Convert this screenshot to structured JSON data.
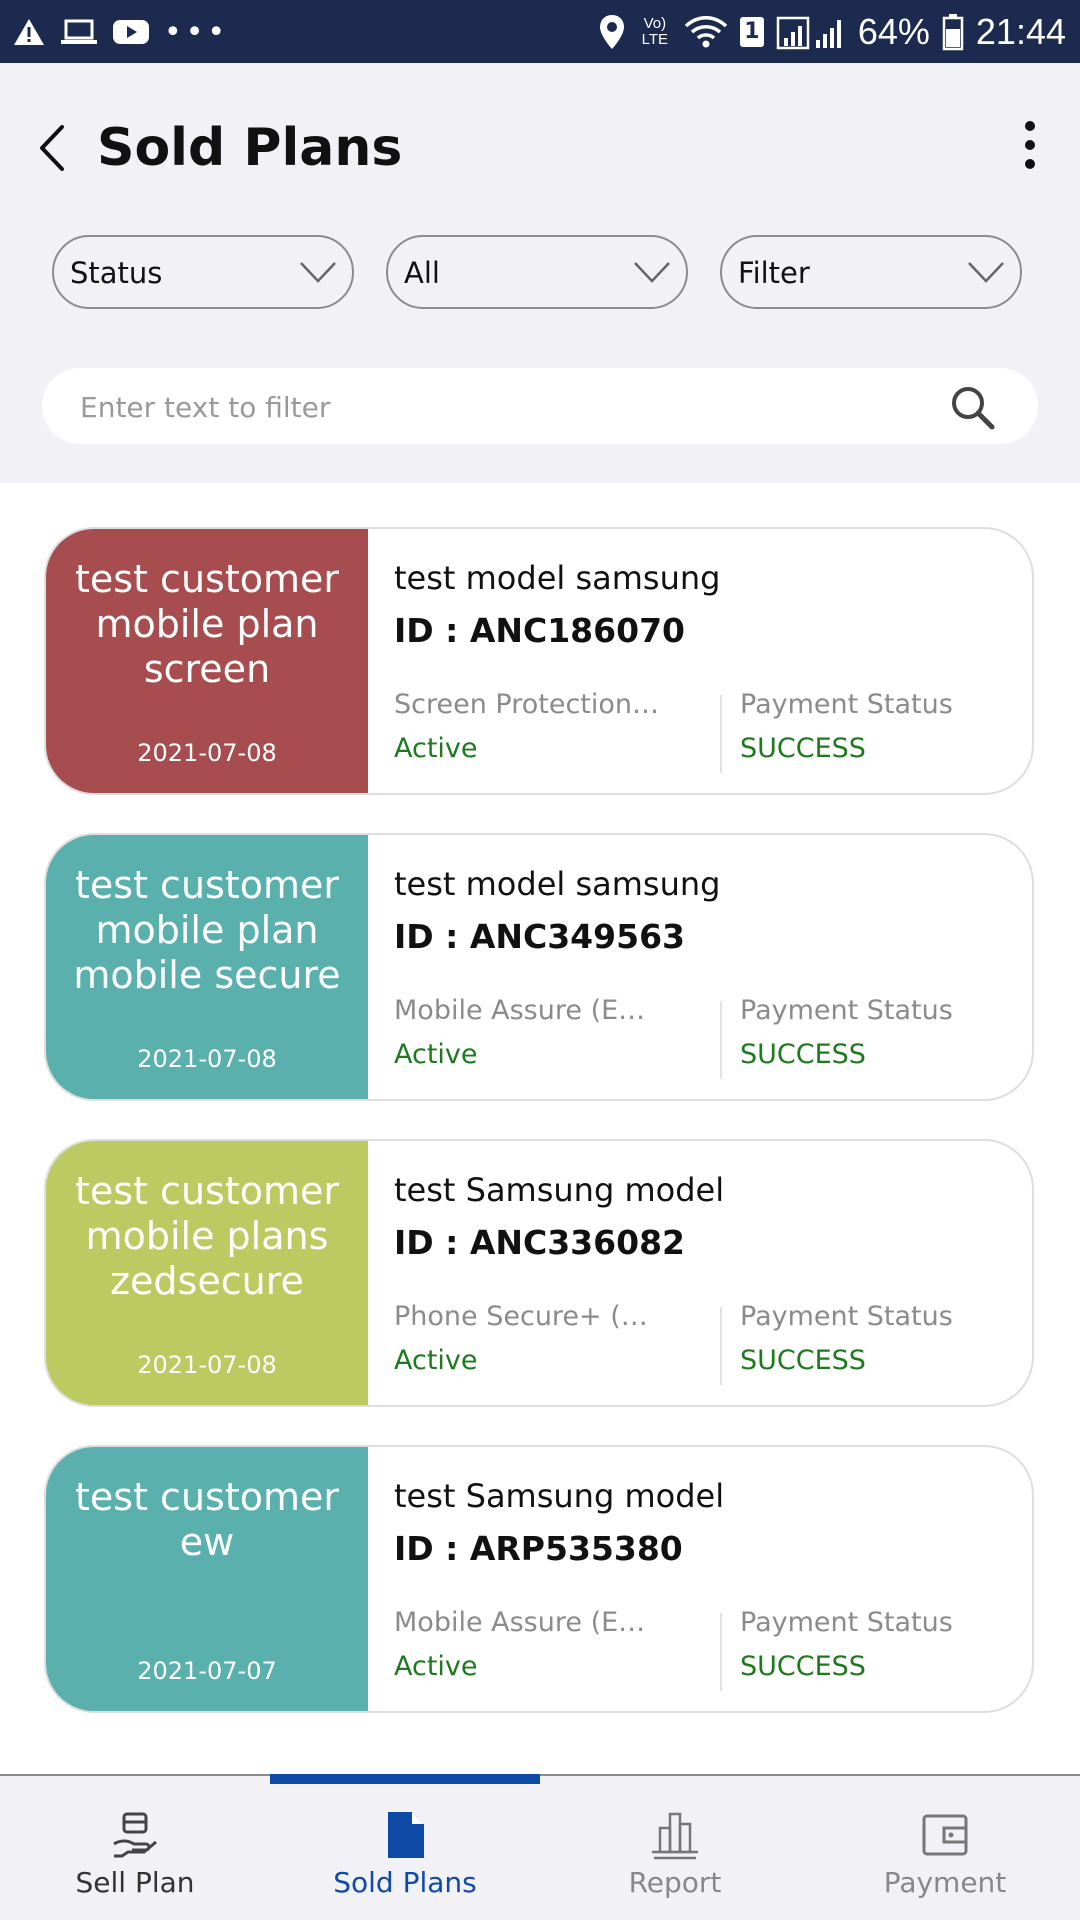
{
  "status_bar": {
    "battery": "64%",
    "time": "21:44",
    "volte": "Vo) LTE",
    "sim": "1"
  },
  "header": {
    "title": "Sold Plans"
  },
  "filters": [
    {
      "label": "Status"
    },
    {
      "label": "All"
    },
    {
      "label": "Filter"
    }
  ],
  "search": {
    "placeholder": "Enter text to filter",
    "value": ""
  },
  "colors": {
    "card_red": "#a84d4f",
    "card_teal": "#59b0ad",
    "card_green": "#bcca62",
    "status_green": "#1d7a1d",
    "nav_active": "#0e4aa6",
    "status_bar": "#1b2a4e"
  },
  "plans": [
    {
      "customer": "test customer mobile plan screen",
      "date": "2021-07-08",
      "model": "test model samsung",
      "id": "ID : ANC186070",
      "plan": "Screen Protection…",
      "status": "Active",
      "payment_label": "Payment Status",
      "payment_status": "SUCCESS",
      "color": "#a84d4f"
    },
    {
      "customer": "test customer mobile plan mobile secure",
      "date": "2021-07-08",
      "model": "test model samsung",
      "id": "ID : ANC349563",
      "plan": "Mobile Assure (E…",
      "status": "Active",
      "payment_label": "Payment Status",
      "payment_status": "SUCCESS",
      "color": "#59b0ad"
    },
    {
      "customer": "test customer mobile plans zedsecure",
      "date": "2021-07-08",
      "model": "test Samsung model",
      "id": "ID : ANC336082",
      "plan": "Phone Secure+ (A…",
      "status": "Active",
      "payment_label": "Payment Status",
      "payment_status": "SUCCESS",
      "color": "#bcca62"
    },
    {
      "customer": "test customer ew",
      "date": "2021-07-07",
      "model": "test Samsung model",
      "id": "ID : ARP535380",
      "plan": "Mobile Assure (E…",
      "status": "Active",
      "payment_label": "Payment Status",
      "payment_status": "SUCCESS",
      "color": "#59b0ad"
    }
  ],
  "bottom_nav": {
    "items": [
      {
        "label": "Sell Plan",
        "icon": "sell-plan-icon",
        "active": false
      },
      {
        "label": "Sold Plans",
        "icon": "document-icon",
        "active": true
      },
      {
        "label": "Report",
        "icon": "bar-chart-icon",
        "active": false
      },
      {
        "label": "Payment",
        "icon": "wallet-icon",
        "active": false
      }
    ]
  }
}
